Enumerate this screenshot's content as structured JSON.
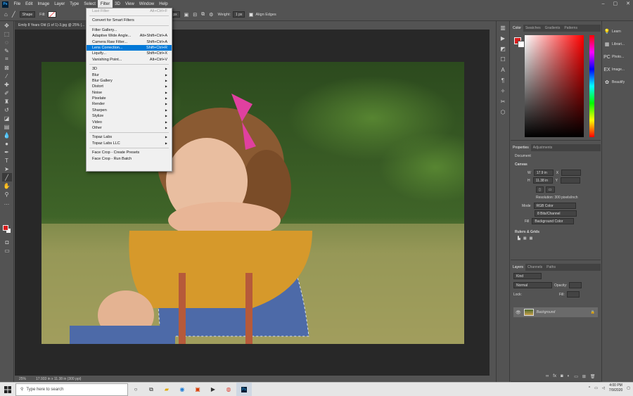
{
  "menubar": {
    "logo": "Ps",
    "items": [
      "File",
      "Edit",
      "Image",
      "Layer",
      "Type",
      "Select",
      "Filter",
      "3D",
      "View",
      "Window",
      "Help"
    ],
    "active_index": 6
  },
  "options_bar": {
    "shape_label": "Shape",
    "fill_label": "Fill:",
    "h_label": "H:",
    "h_value": "0 px",
    "weight_label": "Weight:",
    "weight_value": "1 px",
    "align_edges_label": "Align Edges"
  },
  "document": {
    "tab_title": "Emily 8 Years Old (1 of 1)-3.jpg @ 25% (...",
    "zoom": "25%",
    "doc_info": "17.933 in x 11.38 in (300 ppi)"
  },
  "filter_menu": {
    "items": [
      {
        "label": "Last Filter",
        "shortcut": "Alt+Ctrl+F",
        "disabled": true
      },
      {
        "sep": true
      },
      {
        "label": "Convert for Smart Filters"
      },
      {
        "sep": true
      },
      {
        "label": "Filter Gallery..."
      },
      {
        "label": "Adaptive Wide Angle...",
        "shortcut": "Alt+Shift+Ctrl+A"
      },
      {
        "label": "Camera Raw Filter...",
        "shortcut": "Shift+Ctrl+A"
      },
      {
        "label": "Lens Correction...",
        "shortcut": "Shift+Ctrl+R",
        "highlight": true
      },
      {
        "label": "Liquify...",
        "shortcut": "Shift+Ctrl+X"
      },
      {
        "label": "Vanishing Point...",
        "shortcut": "Alt+Ctrl+V"
      },
      {
        "sep": true
      },
      {
        "label": "3D",
        "submenu": true
      },
      {
        "label": "Blur",
        "submenu": true
      },
      {
        "label": "Blur Gallery",
        "submenu": true
      },
      {
        "label": "Distort",
        "submenu": true
      },
      {
        "label": "Noise",
        "submenu": true
      },
      {
        "label": "Pixelate",
        "submenu": true
      },
      {
        "label": "Render",
        "submenu": true
      },
      {
        "label": "Sharpen",
        "submenu": true
      },
      {
        "label": "Stylize",
        "submenu": true
      },
      {
        "label": "Video",
        "submenu": true
      },
      {
        "label": "Other",
        "submenu": true
      },
      {
        "sep": true
      },
      {
        "label": "Topaz Labs",
        "submenu": true
      },
      {
        "label": "Topaz Labs LLC",
        "submenu": true
      },
      {
        "sep": true
      },
      {
        "label": "Face Crop - Create Presets"
      },
      {
        "label": "Face Crop - Run Batch"
      }
    ]
  },
  "color_panel": {
    "tabs": [
      "Color",
      "Swatches",
      "Gradients",
      "Patterns"
    ],
    "fg_color": "#d91c1c",
    "bg_color": "#ffffff"
  },
  "properties_panel": {
    "tabs": [
      "Properties",
      "Adjustments"
    ],
    "doc_label": "Document",
    "canvas_label": "Canvas",
    "w_label": "W",
    "w_value": "17.9 in",
    "x_label": "X",
    "h_label": "H",
    "h_value": "11.38 in",
    "y_label": "Y",
    "resolution": "Resolution: 300 pixels/inch",
    "mode_label": "Mode",
    "mode_value": "RGB Color",
    "depth_value": "8 Bits/Channel",
    "fill_label": "Fill",
    "fill_value": "Background Color",
    "rulers_label": "Rulers & Grids"
  },
  "layers_panel": {
    "tabs": [
      "Layers",
      "Channels",
      "Paths"
    ],
    "kind_placeholder": "Kind",
    "blend_mode": "Normal",
    "opacity_label": "Opacity:",
    "lock_label": "Lock:",
    "fill_label": "Fill:",
    "layer_name": "Background"
  },
  "right_column": {
    "items": [
      {
        "icon": "lightbulb-icon",
        "label": "Learn"
      },
      {
        "icon": "library-icon",
        "label": "Librari..."
      },
      {
        "icon": "pc-icon",
        "label": "Photo..."
      },
      {
        "icon": "ex-icon",
        "label": "Image..."
      },
      {
        "icon": "beautify-icon",
        "label": "Beautify"
      }
    ]
  },
  "taskbar": {
    "search_placeholder": "Type here to search",
    "time": "4:00 PM",
    "date": "7/9/2020"
  }
}
